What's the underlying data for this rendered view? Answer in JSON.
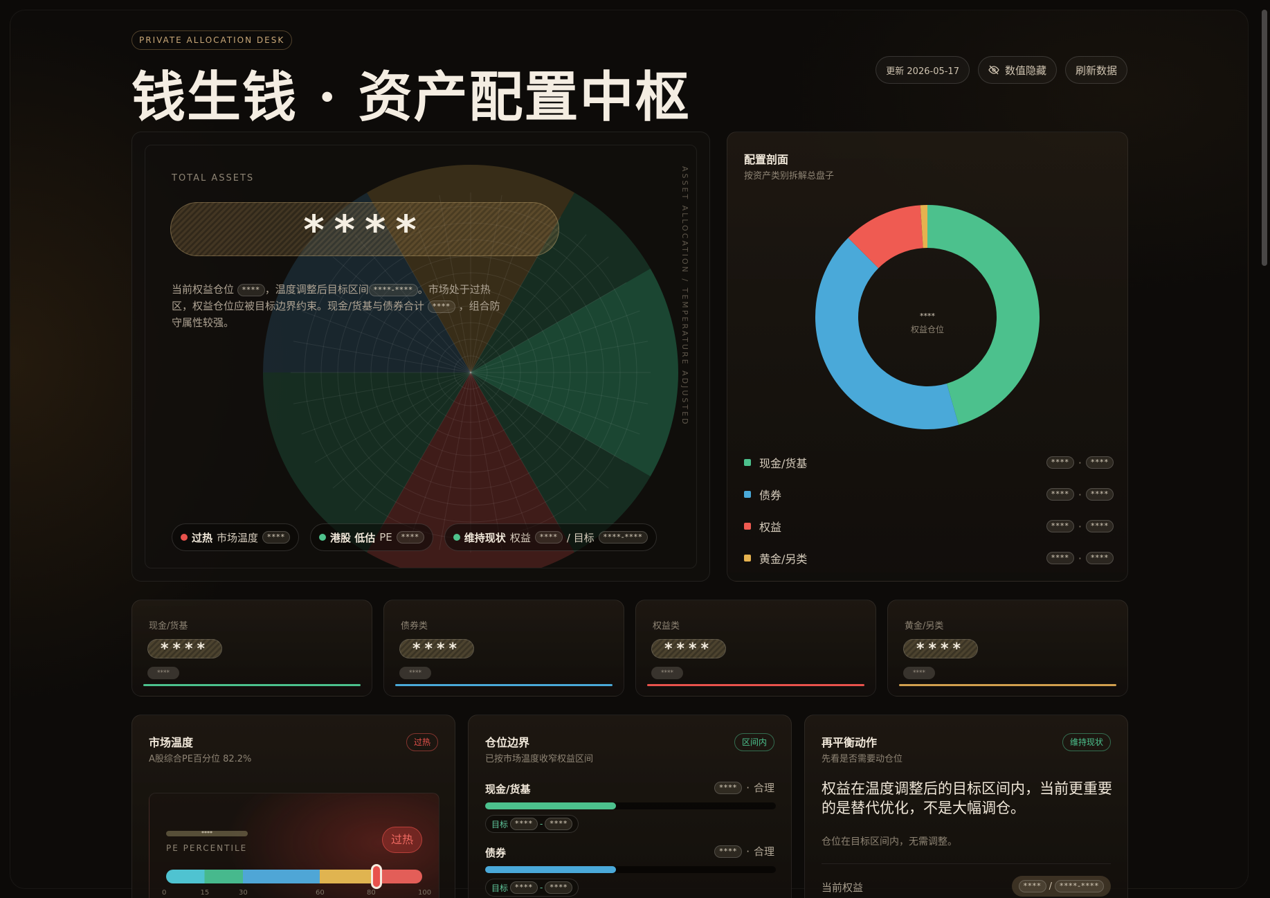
{
  "header": {
    "desk_tag": "PRIVATE ALLOCATION DESK",
    "title": "钱生钱 · 资产配置中枢",
    "updated": "更新 2026-05-17",
    "hide_values": "数值隐藏",
    "refresh": "刷新数据"
  },
  "hero": {
    "label": "TOTAL ASSETS",
    "total_masked": "****",
    "desc_parts": [
      "当前权益仓位 ",
      "****",
      "，温度调整后目标区间",
      "****-****",
      "。市场处于过热区，权益仓位应被目标边界约束。现金/货基与债券合计 ",
      "****",
      " ，组合防守属性较强。"
    ],
    "side_text": "ASSET ALLOCATION / TEMPERATURE ADJUSTED",
    "chips": [
      {
        "status": "过热",
        "label": "市场温度",
        "value": "****",
        "color": "#e8524c"
      },
      {
        "status": "港股 低估",
        "label": "PE",
        "value": "****",
        "color": "#4fc38d"
      },
      {
        "status": "维持现状",
        "label": "权益",
        "value": "****",
        "sep": "/ 目标",
        "value2": "****-****",
        "color": "#4fc38d"
      }
    ]
  },
  "allocation": {
    "title": "配置剖面",
    "subtitle": "按资产类别拆解总盘子",
    "center_value": "****",
    "center_label": "权益仓位",
    "items": [
      {
        "name": "现金/货基",
        "v1": "****",
        "v2": "****",
        "color": "#4cc18d",
        "share": 0.455
      },
      {
        "name": "债券",
        "v1": "****",
        "v2": "****",
        "color": "#4aa9d9",
        "share": 0.42
      },
      {
        "name": "权益",
        "v1": "****",
        "v2": "****",
        "color": "#ef5b52",
        "share": 0.115
      },
      {
        "name": "黄金/另类",
        "v1": "****",
        "v2": "****",
        "color": "#e6b24f",
        "share": 0.01
      }
    ]
  },
  "summary": [
    {
      "label": "现金/货基",
      "value": "****",
      "sub": "****",
      "color": "#4cc18d"
    },
    {
      "label": "债券类",
      "value": "****",
      "sub": "****",
      "color": "#4aa9d9"
    },
    {
      "label": "权益类",
      "value": "****",
      "sub": "****",
      "color": "#e8524c"
    },
    {
      "label": "黄金/另类",
      "value": "****",
      "sub": "****",
      "color": "#d1a04e"
    }
  ],
  "temperature": {
    "title": "市场温度",
    "subtitle": "A股综合PE百分位 82.2%",
    "badge": "过热",
    "big_badge": "过热",
    "mask": "****",
    "caption": "PE PERCENTILE",
    "percentile": 82.2,
    "ticks": [
      "0",
      "15",
      "30",
      "60",
      "80",
      "100"
    ]
  },
  "positions": {
    "title": "仓位边界",
    "subtitle": "已按市场温度收窄权益区间",
    "badge": "区间内",
    "rows": [
      {
        "name": "现金/货基",
        "value": "****",
        "status": "合理",
        "target_label": "目标",
        "t1": "****",
        "t2": "****",
        "fill": 0.45,
        "color": "#4cc18d"
      },
      {
        "name": "债券",
        "value": "****",
        "status": "合理",
        "target_label": "目标",
        "t1": "****",
        "t2": "****",
        "fill": 0.45,
        "color": "#4aa9d9"
      }
    ]
  },
  "rebalance": {
    "title": "再平衡动作",
    "subtitle": "先看是否需要动仓位",
    "badge": "维持现状",
    "main": "权益在温度调整后的目标区间内，当前更重要的是替代优化，不是大幅调仓。",
    "note": "仓位在目标区间内，无需调整。",
    "row_label": "当前权益",
    "row_v1": "****",
    "row_v2": "****-****"
  }
}
